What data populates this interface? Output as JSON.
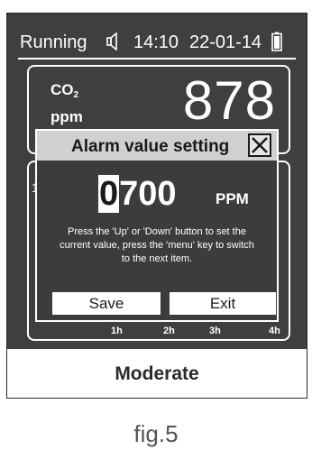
{
  "status_bar": {
    "state": "Running",
    "time": "14:10",
    "date": "22-01-14",
    "speaker_icon": "speaker-icon",
    "battery_icon": "battery-icon"
  },
  "co2_panel": {
    "label": "CO",
    "label_subscript": "2",
    "unit": "ppm",
    "value": "878"
  },
  "chart": {
    "edge_mark": "1",
    "time_labels": [
      "1h",
      "2h",
      "3h",
      "4h"
    ]
  },
  "dialog": {
    "title": "Alarm value setting",
    "value_first_digit": "0",
    "value_rest": "700",
    "unit": "PPM",
    "help_text": "Press the 'Up' or 'Down' button to set the current value,  press the 'menu' key to switch to the next item.",
    "save_label": "Save",
    "exit_label": "Exit",
    "close_icon": "close-icon"
  },
  "footer": {
    "air_quality": "Moderate"
  },
  "caption": "fig.5"
}
